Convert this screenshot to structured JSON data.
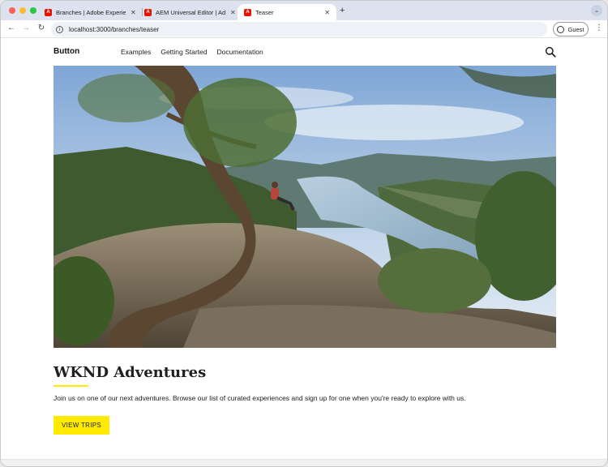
{
  "browser": {
    "tabs": [
      {
        "title": "Branches | Adobe Experience Manager",
        "favicon": "adobe-icon",
        "active": false
      },
      {
        "title": "AEM Universal Editor | Adobe",
        "favicon": "adobe-icon",
        "active": false
      },
      {
        "title": "Teaser",
        "favicon": "adobe-icon",
        "active": true
      }
    ],
    "url": "localhost:3000/branches/teaser",
    "profile_label": "Guest"
  },
  "site": {
    "brand": "Button",
    "nav": [
      "Examples",
      "Getting Started",
      "Documentation"
    ]
  },
  "teaser": {
    "title": "WKND Adventures",
    "description": "Join us on one of our next adventures. Browse our list of curated experiences and sign up for one when you're ready to explore with us.",
    "cta_label": "VIEW TRIPS",
    "image_alt": "Hiker sitting on a rock overlooking a river valley",
    "accent_color": "#ffea00"
  }
}
